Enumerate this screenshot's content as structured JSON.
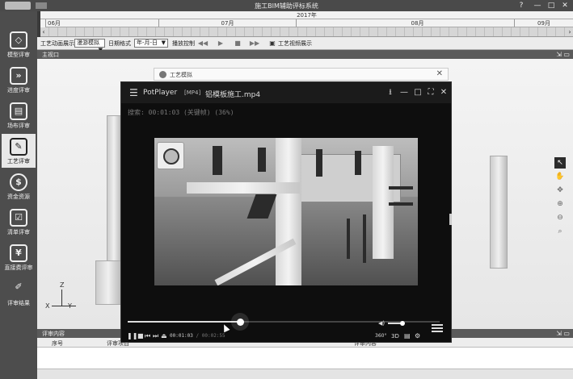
{
  "window": {
    "title": "施工BIM辅助评标系统",
    "controls": {
      "help": "?",
      "minimize": "—",
      "maximize": "□",
      "close": "✕"
    }
  },
  "timeline": {
    "year": "2017年",
    "months": [
      "06月",
      "07月",
      "08月",
      "09月"
    ]
  },
  "sidebar": {
    "items": [
      {
        "label": "模型评审",
        "icon": "cube-icon",
        "glyph": "◇"
      },
      {
        "label": "进度评审",
        "icon": "progress-icon",
        "glyph": "»"
      },
      {
        "label": "场布评审",
        "icon": "clapboard-icon",
        "glyph": "▤"
      },
      {
        "label": "工艺评审",
        "icon": "edit-icon",
        "glyph": "✎"
      },
      {
        "label": "资金资源",
        "icon": "dollar-icon",
        "glyph": "$"
      },
      {
        "label": "清单评审",
        "icon": "checklist-icon",
        "glyph": "☑"
      },
      {
        "label": "直接费评审",
        "icon": "cost-doc-icon",
        "glyph": "¥"
      },
      {
        "label": "评审结果",
        "icon": "pen-icon",
        "glyph": "✐"
      }
    ]
  },
  "toolbar": {
    "anim_label": "工艺动画展示",
    "anim_value": "漫游模拟",
    "date_label": "日期格式",
    "date_value": "年-月-日",
    "playback_label": "播放控制",
    "video_label": "工艺视频展示",
    "dropdown_arrow": "▼",
    "icons": {
      "rewind": "◀◀",
      "play": "▶",
      "stop": "■",
      "forward": "▶▶",
      "video": "▣"
    }
  },
  "viewport": {
    "title": "主视口",
    "axis": {
      "x": "X",
      "y": "Y",
      "z": "Z"
    },
    "ctrl": "⇲ ▭",
    "tools": {
      "pointer": "↖",
      "pan": "✋",
      "orbit": "✥",
      "zoom_in": "⊕",
      "zoom_out": "⊖",
      "zoom_fit": "⌕"
    }
  },
  "sim_window": {
    "title": "工艺模拟",
    "close": "✕"
  },
  "player": {
    "app": "PotPlayer",
    "format": "[MP4]",
    "file": "铝模板施工.mp4",
    "seek_info": "搜索: 00:01:03 (关键帧) (36%)",
    "position": "00:01:03",
    "duration": "00:02:55",
    "progress": 0.36,
    "volume": 0.75,
    "buttons": {
      "menu": "☰",
      "pin": "⭳",
      "min": "—",
      "max": "□",
      "full": "⛶",
      "close": "✕",
      "pause": "❚❚",
      "stop": "■",
      "prev": "⏮",
      "next": "⏭",
      "eject": "⏏",
      "deg360": "360°",
      "three_d": "3D",
      "subtitles": "▤",
      "settings": "⚙",
      "speaker": "◀)"
    },
    "time_sep": " / "
  },
  "eval_panel": {
    "title": "评审内容",
    "ctrl": "⇲ ▭",
    "columns": {
      "index": "序号",
      "item": "评审项目",
      "content": "评审内容"
    }
  }
}
